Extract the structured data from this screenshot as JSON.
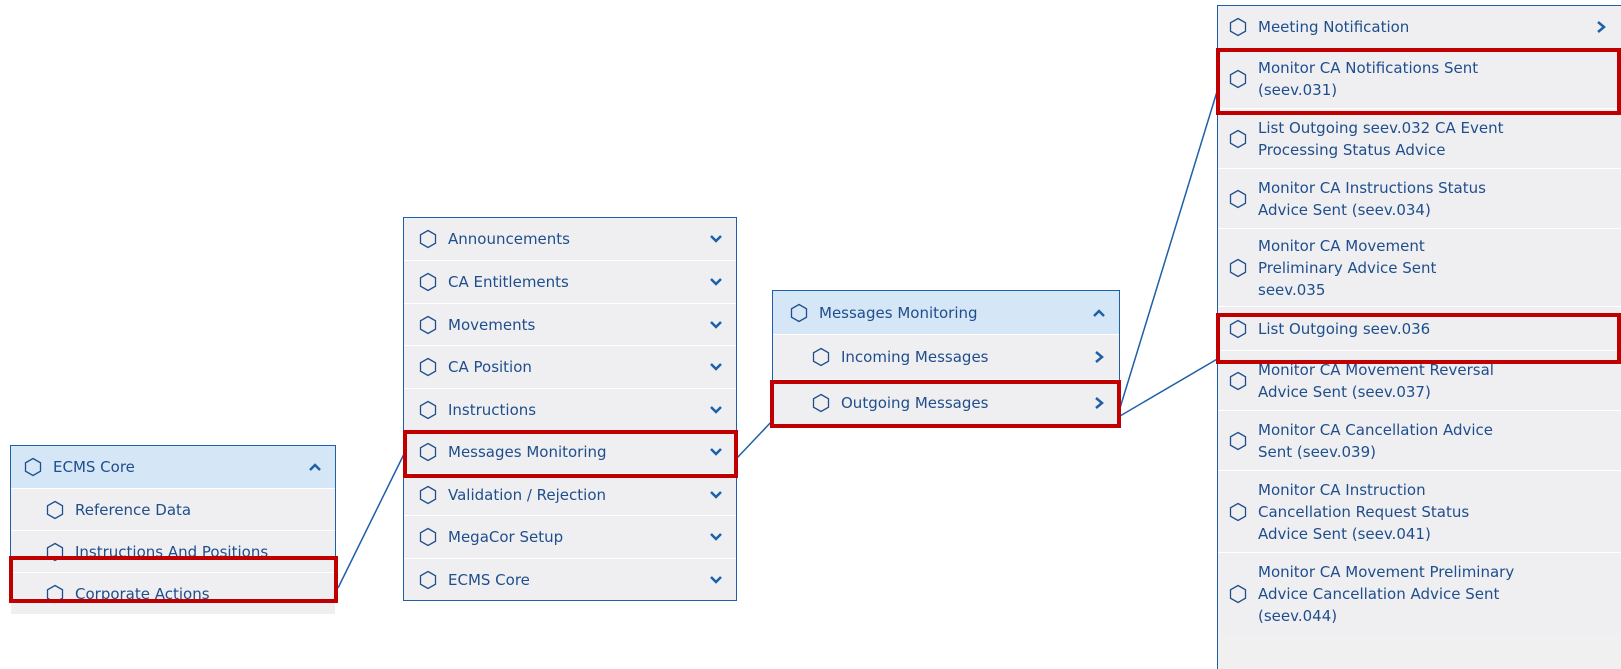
{
  "colors": {
    "accent": "#1f5fa8",
    "highlight": "#c00000",
    "header_bg": "#d5e6f7",
    "row_bg": "#efeff2"
  },
  "panel1": {
    "header": {
      "label": "ECMS Core",
      "icon": "chevron-up-icon"
    },
    "items": [
      {
        "label": "Reference Data"
      },
      {
        "label": "Instructions And Positions"
      },
      {
        "label": "Corporate Actions"
      }
    ]
  },
  "panel2": {
    "items": [
      {
        "label": "Announcements"
      },
      {
        "label": "CA Entitlements"
      },
      {
        "label": "Movements"
      },
      {
        "label": "CA Position"
      },
      {
        "label": "Instructions"
      },
      {
        "label": "Messages Monitoring"
      },
      {
        "label": "Validation / Rejection"
      },
      {
        "label": "MegaCor Setup"
      },
      {
        "label": "ECMS Core"
      }
    ]
  },
  "panel3": {
    "header": {
      "label": "Messages Monitoring"
    },
    "items": [
      {
        "label": "Incoming Messages"
      },
      {
        "label": "Outgoing Messages"
      }
    ]
  },
  "panel4": {
    "items": [
      {
        "label": "Meeting Notification"
      },
      {
        "label": "Monitor CA Notifications Sent (seev.031)"
      },
      {
        "label": "List Outgoing seev.032 CA Event Processing Status Advice"
      },
      {
        "label": "Monitor CA Instructions Status Advice Sent (seev.034)"
      },
      {
        "label": "Monitor CA Movement Preliminary Advice Sent seev.035"
      },
      {
        "label": "List Outgoing seev.036"
      },
      {
        "label": "Monitor CA Movement Reversal Advice Sent (seev.037)"
      },
      {
        "label": "Monitor CA Cancellation Advice Sent (seev.039)"
      },
      {
        "label": "Monitor CA Instruction Cancellation Request Status Advice Sent (seev.041)"
      },
      {
        "label": "Monitor CA Movement Preliminary Advice Cancellation Advice Sent (seev.044)"
      }
    ]
  }
}
